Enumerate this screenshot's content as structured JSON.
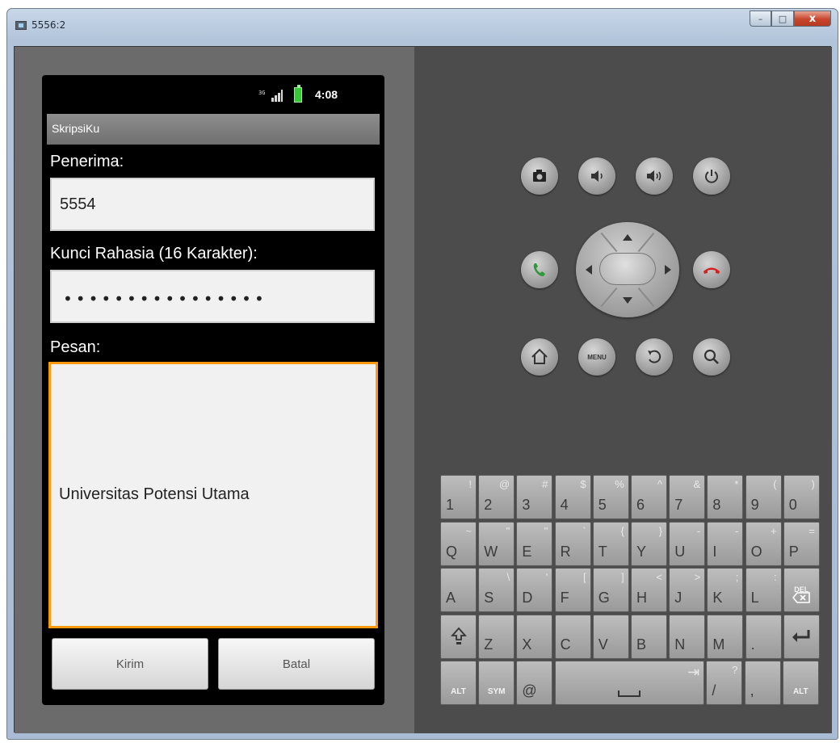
{
  "window": {
    "title": "5556:2",
    "minimize": "–",
    "maximize": "□",
    "close": "x"
  },
  "status_bar": {
    "sim_text": "3G",
    "time": "4:08"
  },
  "app": {
    "title": "SkripsiKu",
    "recipient_label": "Penerima:",
    "recipient_value": "5554",
    "key_label": "Kunci Rahasia (16 Karakter):",
    "key_value": "••••••••••••••••",
    "message_label": "Pesan:",
    "message_value": "Universitas Potensi Utama",
    "send_button": "Kirim",
    "cancel_button": "Batal"
  },
  "hardware": {
    "menu_label": "MENU",
    "buttons": [
      "camera-icon",
      "volume-down-icon",
      "volume-up-icon",
      "power-icon",
      "call-icon",
      "dpad",
      "end-call-icon",
      "home-icon",
      "menu",
      "back-icon",
      "search-icon"
    ]
  },
  "keyboard": {
    "rows": [
      [
        {
          "main": "1",
          "alt": "!"
        },
        {
          "main": "2",
          "alt": "@"
        },
        {
          "main": "3",
          "alt": "#"
        },
        {
          "main": "4",
          "alt": "$"
        },
        {
          "main": "5",
          "alt": "%"
        },
        {
          "main": "6",
          "alt": "^"
        },
        {
          "main": "7",
          "alt": "&"
        },
        {
          "main": "8",
          "alt": "*"
        },
        {
          "main": "9",
          "alt": "("
        },
        {
          "main": "0",
          "alt": ")"
        }
      ],
      [
        {
          "main": "Q",
          "alt": "~"
        },
        {
          "main": "W",
          "alt": "\""
        },
        {
          "main": "E",
          "alt": "\""
        },
        {
          "main": "R",
          "alt": "`"
        },
        {
          "main": "T",
          "alt": "{"
        },
        {
          "main": "Y",
          "alt": "}"
        },
        {
          "main": "U",
          "alt": "-"
        },
        {
          "main": "I",
          "alt": "-"
        },
        {
          "main": "O",
          "alt": "+"
        },
        {
          "main": "P",
          "alt": "="
        }
      ],
      [
        {
          "main": "A",
          "alt": ""
        },
        {
          "main": "S",
          "alt": "\\"
        },
        {
          "main": "D",
          "alt": "'"
        },
        {
          "main": "F",
          "alt": "["
        },
        {
          "main": "G",
          "alt": "]"
        },
        {
          "main": "H",
          "alt": "<"
        },
        {
          "main": "J",
          "alt": ">"
        },
        {
          "main": "K",
          "alt": ";"
        },
        {
          "main": "L",
          "alt": ":"
        },
        {
          "main": "DEL",
          "alt": ""
        }
      ],
      [
        {
          "main": "⇧",
          "alt": ""
        },
        {
          "main": "Z",
          "alt": ""
        },
        {
          "main": "X",
          "alt": ""
        },
        {
          "main": "C",
          "alt": ""
        },
        {
          "main": "V",
          "alt": ""
        },
        {
          "main": "B",
          "alt": ""
        },
        {
          "main": "N",
          "alt": ""
        },
        {
          "main": "M",
          "alt": ""
        },
        {
          "main": ".",
          "alt": ""
        },
        {
          "main": "↵",
          "alt": ""
        }
      ],
      [
        {
          "main": "ALT",
          "alt": ""
        },
        {
          "main": "SYM",
          "alt": ""
        },
        {
          "main": "@",
          "alt": ""
        },
        {
          "main": "",
          "alt": "⇥"
        },
        {
          "main": "/",
          "alt": "?"
        },
        {
          "main": ",",
          "alt": ""
        },
        {
          "main": "ALT",
          "alt": ""
        }
      ]
    ],
    "colors": {
      "key_top": "#bdbdbd",
      "key_bottom": "#9a9a9a"
    }
  },
  "colors": {
    "emulator_bg": "#4c4c4c",
    "focus_border": "#ff9a10",
    "call_green": "#2e9a3a",
    "end_red": "#d32020"
  }
}
